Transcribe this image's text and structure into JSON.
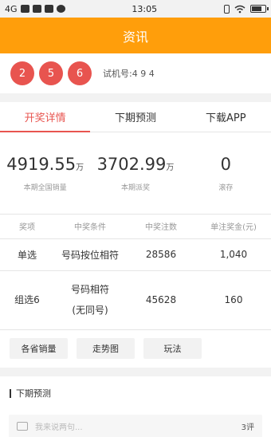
{
  "status_bar": {
    "signal": "4G",
    "time": "13:05"
  },
  "header": {
    "title": "资讯"
  },
  "draw": {
    "balls": [
      "2",
      "5",
      "6"
    ],
    "trial_label": "试机号:4 9 4"
  },
  "tabs": [
    {
      "label": "开奖详情",
      "active": true
    },
    {
      "label": "下期预测",
      "active": false
    },
    {
      "label": "下载APP",
      "active": false
    }
  ],
  "stats": [
    {
      "value": "4919.55",
      "unit": "万",
      "label": "本期全国销量"
    },
    {
      "value": "3702.99",
      "unit": "万",
      "label": "本期派奖"
    },
    {
      "value": "0",
      "unit": "",
      "label": "滚存"
    }
  ],
  "table": {
    "headers": [
      "奖项",
      "中奖条件",
      "中奖注数",
      "单注奖金(元)"
    ],
    "rows": [
      [
        "单选",
        "号码按位相符",
        "28586",
        "1,040"
      ],
      [
        "组选6",
        "号码相符(无同号)",
        "45628",
        "160"
      ]
    ]
  },
  "links": [
    "各省销量",
    "走势图",
    "玩法"
  ],
  "prediction": {
    "title": "下期预测",
    "comment_placeholder": "我来说两句...",
    "comment_count": "3评"
  }
}
